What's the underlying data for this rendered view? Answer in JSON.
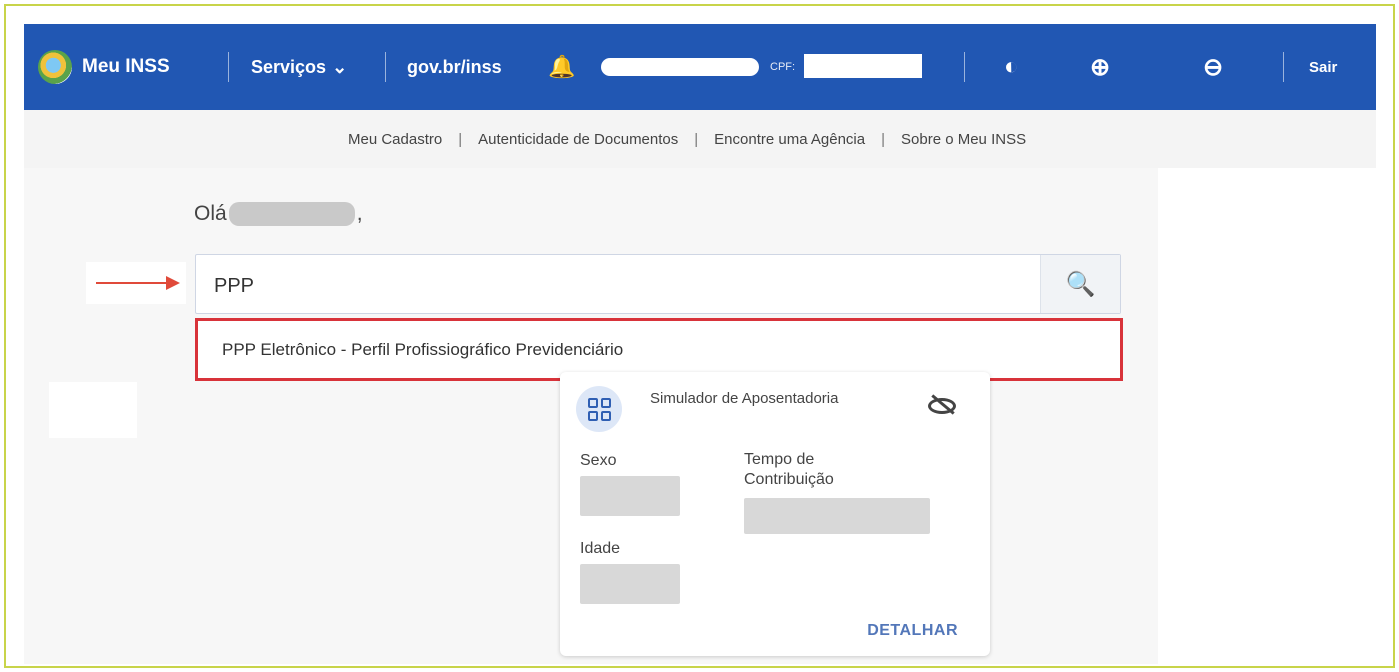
{
  "colors": {
    "header_bg": "#2157b3",
    "highlight_border": "#d8333a",
    "arrow": "#e04a3a",
    "link": "#5377b9"
  },
  "header": {
    "logo_text": "Meu INSS",
    "servicos_label": "Serviços",
    "govbr_label": "gov.br/inss",
    "cpf_label": "CPF:",
    "sair_label": "Sair"
  },
  "subnav": {
    "items": [
      "Meu Cadastro",
      "Autenticidade de Documentos",
      "Encontre uma Agência",
      "Sobre o Meu INSS"
    ],
    "separator": "|"
  },
  "greeting": {
    "prefix": "Olá",
    "suffix": ","
  },
  "search": {
    "value": "PPP",
    "button_icon": "search-icon"
  },
  "suggestion": {
    "label": "PPP Eletrônico - Perfil Profissiográfico Previdenciário"
  },
  "card": {
    "title": "Simulador de Aposentadoria",
    "sexo_label": "Sexo",
    "tempo_label": "Tempo de Contribuição",
    "idade_label": "Idade",
    "detalhar_label": "DETALHAR"
  }
}
